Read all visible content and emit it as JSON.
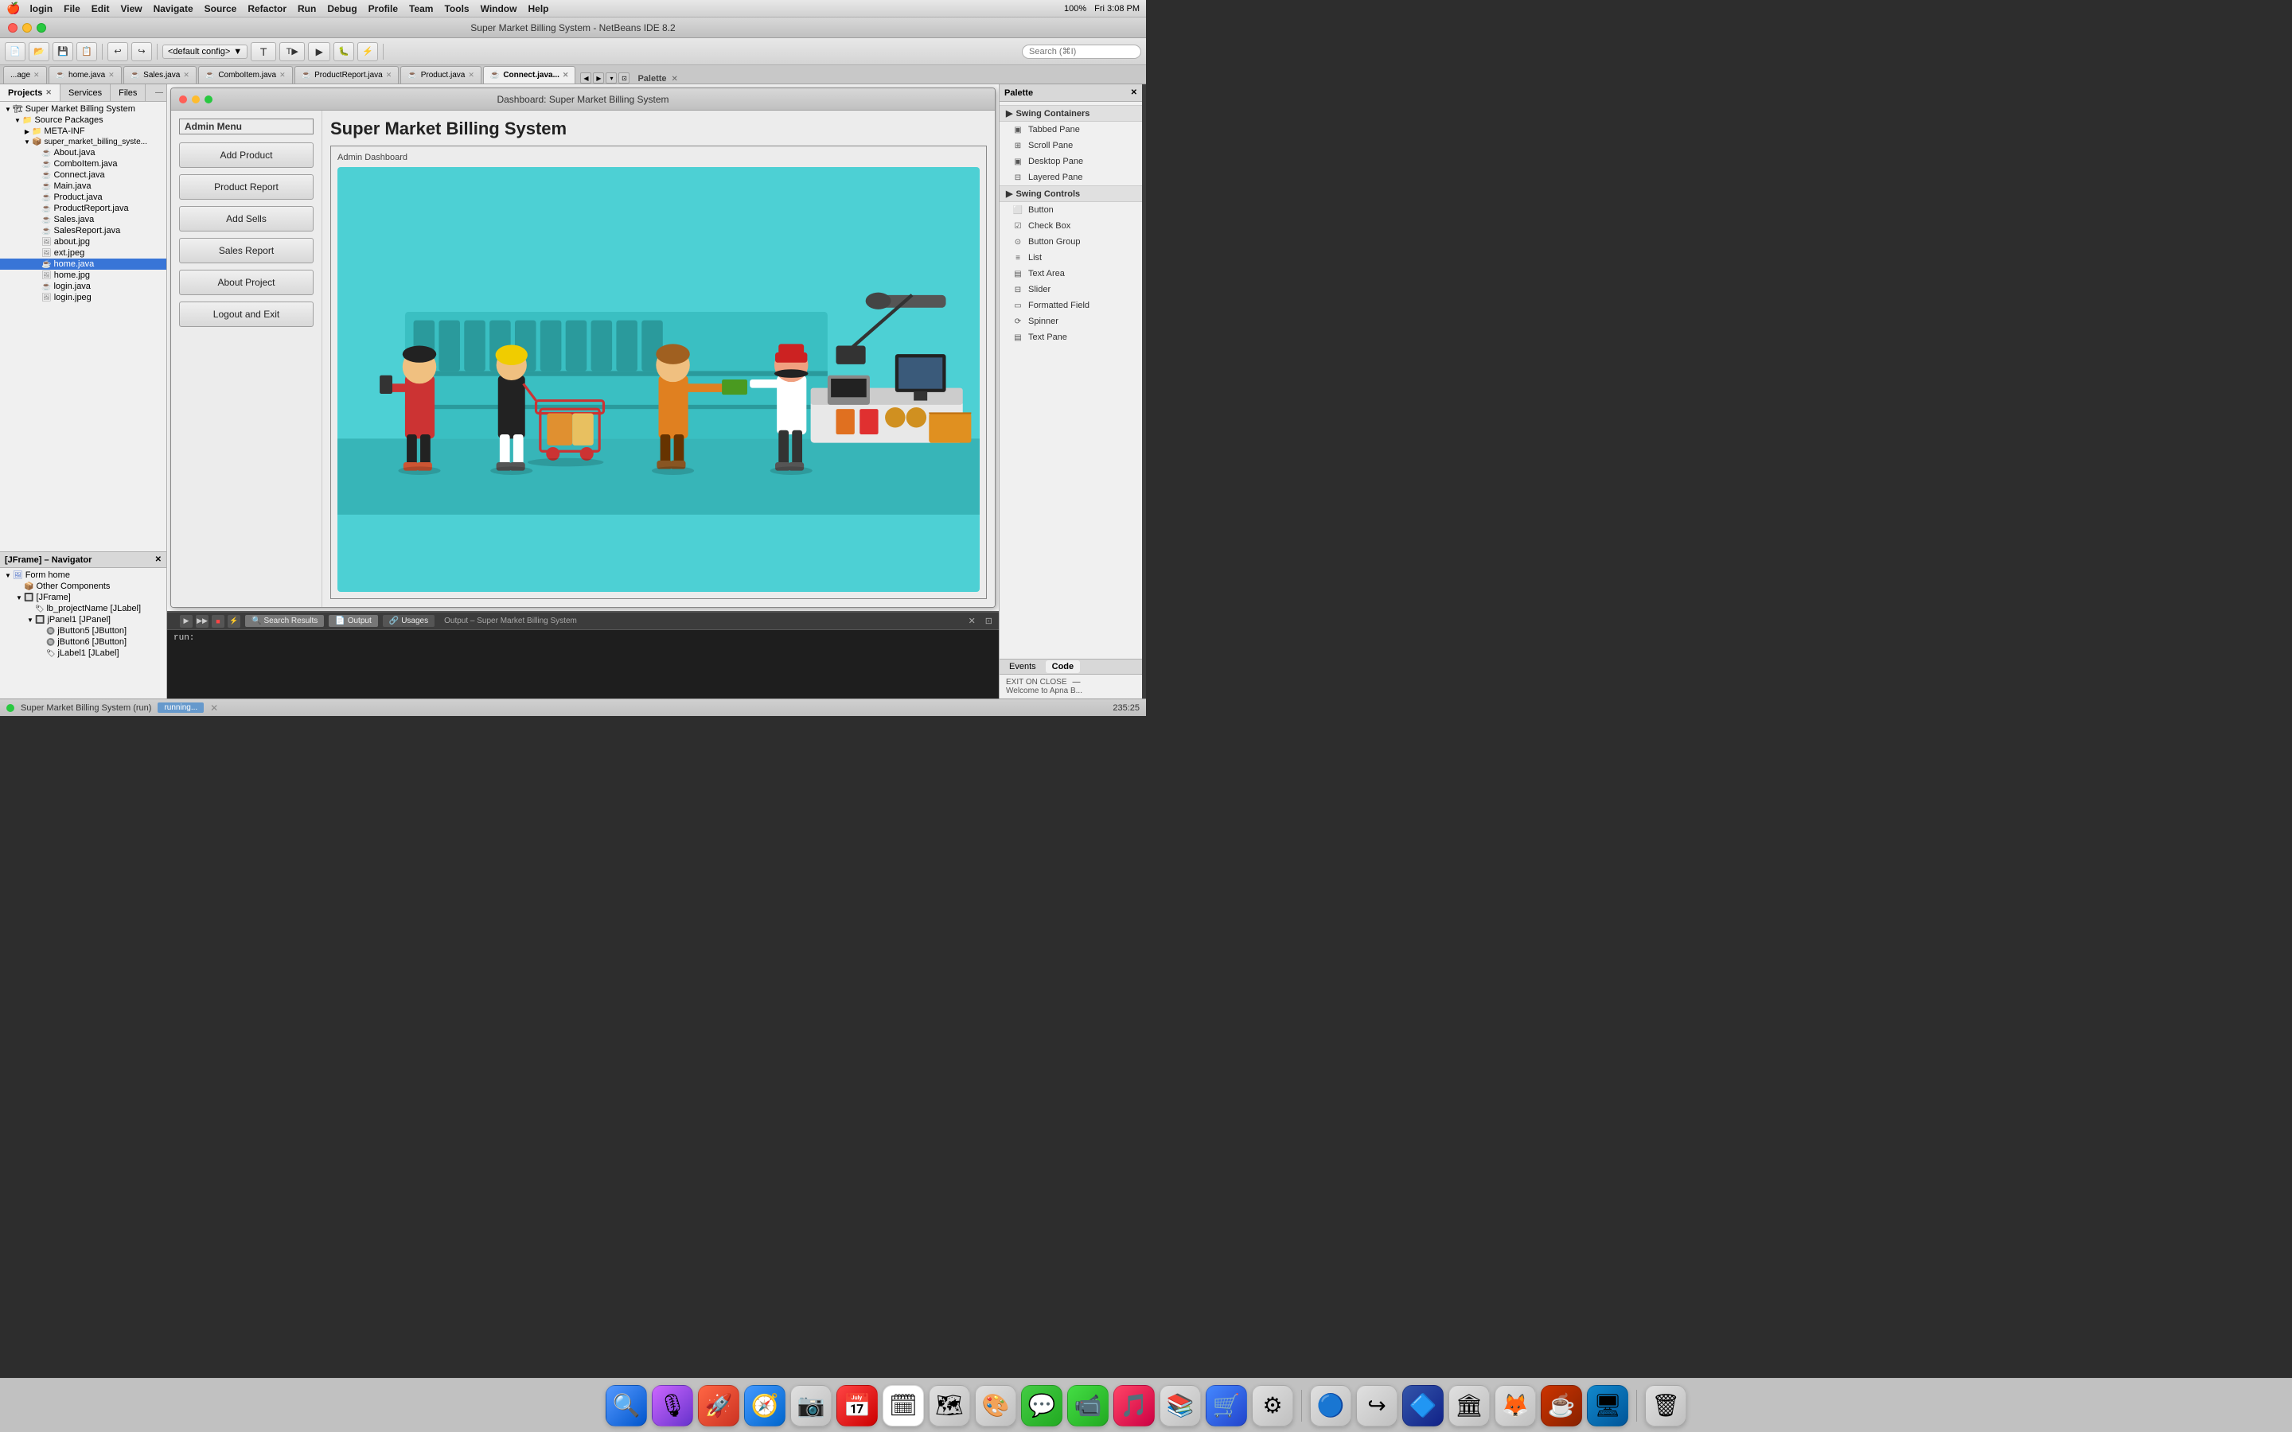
{
  "menubar": {
    "apple": "🍎",
    "app_name": "login",
    "items": [
      "login",
      "File",
      "Edit",
      "View",
      "Navigate",
      "Source",
      "Refactor",
      "Run",
      "Debug",
      "Profile",
      "Team",
      "Tools",
      "Window",
      "Help"
    ],
    "right": {
      "time": "Fri 3:08 PM",
      "battery": "100%"
    }
  },
  "title_bar": {
    "title": "Super Market Billing System - NetBeans IDE 8.2"
  },
  "toolbar": {
    "config_label": "<default config>",
    "search_placeholder": "Search (⌘I)"
  },
  "tabs": [
    {
      "label": "...age",
      "active": false
    },
    {
      "label": "home.java",
      "active": false
    },
    {
      "label": "Sales.java",
      "active": false
    },
    {
      "label": "ComboItem.java",
      "active": false
    },
    {
      "label": "ProductReport.java",
      "active": false
    },
    {
      "label": "Product.java",
      "active": false
    },
    {
      "label": "Connect.java...",
      "active": true
    }
  ],
  "panel_tabs": [
    {
      "label": "Projects",
      "active": true
    },
    {
      "label": "Services",
      "active": false
    },
    {
      "label": "Files",
      "active": false
    }
  ],
  "project_tree": {
    "root": "Super Market Billing System",
    "items": [
      {
        "label": "Source Packages",
        "indent": 1,
        "expanded": true,
        "icon": "📁"
      },
      {
        "label": "META-INF",
        "indent": 2,
        "expanded": false,
        "icon": "📁"
      },
      {
        "label": "super_market_billing_syste...",
        "indent": 2,
        "expanded": true,
        "icon": "📁"
      },
      {
        "label": "About.java",
        "indent": 3,
        "expanded": false,
        "icon": "☕"
      },
      {
        "label": "ComboItem.java",
        "indent": 3,
        "expanded": false,
        "icon": "☕"
      },
      {
        "label": "Connect.java",
        "indent": 3,
        "expanded": false,
        "icon": "☕"
      },
      {
        "label": "Main.java",
        "indent": 3,
        "expanded": false,
        "icon": "☕"
      },
      {
        "label": "Product.java",
        "indent": 3,
        "expanded": false,
        "icon": "☕"
      },
      {
        "label": "ProductReport.java",
        "indent": 3,
        "expanded": false,
        "icon": "☕"
      },
      {
        "label": "Sales.java",
        "indent": 3,
        "expanded": false,
        "icon": "☕"
      },
      {
        "label": "SalesReport.java",
        "indent": 3,
        "expanded": false,
        "icon": "☕"
      },
      {
        "label": "about.jpg",
        "indent": 3,
        "expanded": false,
        "icon": "🖼"
      },
      {
        "label": "ext.jpeg",
        "indent": 3,
        "expanded": false,
        "icon": "🖼"
      },
      {
        "label": "home.java",
        "indent": 3,
        "expanded": false,
        "icon": "☕",
        "selected": true
      },
      {
        "label": "home.jpg",
        "indent": 3,
        "expanded": false,
        "icon": "🖼"
      },
      {
        "label": "login.java",
        "indent": 3,
        "expanded": false,
        "icon": "☕"
      },
      {
        "label": "login.jpeg",
        "indent": 3,
        "expanded": false,
        "icon": "🖼"
      }
    ]
  },
  "navigator": {
    "title": "[JFrame] – Navigator",
    "items": [
      {
        "label": "Form home",
        "indent": 0,
        "icon": "🖼",
        "expanded": true
      },
      {
        "label": "Other Components",
        "indent": 1,
        "icon": "📦"
      },
      {
        "label": "[JFrame]",
        "indent": 1,
        "icon": "🔲",
        "expanded": true
      },
      {
        "label": "lb_projectName [JLabel]",
        "indent": 2,
        "icon": "🏷"
      },
      {
        "label": "jPanel1 [JPanel]",
        "indent": 2,
        "icon": "🔲",
        "expanded": true
      },
      {
        "label": "jButton5 [JButton]",
        "indent": 3,
        "icon": "🔘"
      },
      {
        "label": "jButton6 [JButton]",
        "indent": 3,
        "icon": "🔘"
      },
      {
        "label": "jLabel1 [JLabel]",
        "indent": 3,
        "icon": "🏷"
      }
    ]
  },
  "app_preview": {
    "title": "Dashboard: Super Market Billing System",
    "main_title": "Super Market Billing System",
    "section_title": "Admin Dashboard",
    "admin_menu": {
      "title": "Admin Menu",
      "buttons": [
        "Add Product",
        "Product Report",
        "Add Sells",
        "Sales Report",
        "About Project",
        "Logout and Exit"
      ]
    }
  },
  "output_panel": {
    "title": "Output – Super Market Billing System",
    "tabs": [
      "Search Results",
      "Output",
      "Usages"
    ],
    "active_tab": "Output",
    "content": "run:"
  },
  "status_bar": {
    "project": "Super Market Billing System (run)",
    "run_status": "running...",
    "position": "235:25"
  },
  "palette": {
    "title": "Palette",
    "sections": [
      {
        "title": "Swing Containers",
        "items": [
          {
            "label": "Tabbed Pane",
            "icon": "▣"
          },
          {
            "label": "Scroll Pane",
            "icon": "▣"
          },
          {
            "label": "Desktop Pane",
            "icon": "▣"
          },
          {
            "label": "Layered Pane",
            "icon": "▣"
          }
        ]
      },
      {
        "title": "Swing Controls",
        "items": [
          {
            "label": "Button",
            "icon": "⬜"
          },
          {
            "label": "Check Box",
            "icon": "☑"
          },
          {
            "label": "Button Group",
            "icon": "⊙"
          },
          {
            "label": "List",
            "icon": "≡"
          },
          {
            "label": "Text Area",
            "icon": "▤"
          },
          {
            "label": "Slider",
            "icon": "⊟"
          },
          {
            "label": "Formatted Field",
            "icon": "▭"
          },
          {
            "label": "Spinner",
            "icon": "⟳"
          },
          {
            "label": "Text Pane",
            "icon": "▤"
          }
        ]
      }
    ]
  },
  "events": {
    "tabs": [
      "Events",
      "Code"
    ],
    "active_tab": "Code",
    "property_label": "EXIT ON CLOSE",
    "property_value": "—",
    "watermark": "Welcome to Apna B..."
  },
  "dock_items": [
    {
      "icon": "🔍",
      "label": "Finder"
    },
    {
      "icon": "🎙",
      "label": "Siri"
    },
    {
      "icon": "🚀",
      "label": "Launchpad"
    },
    {
      "icon": "🧭",
      "label": "Safari"
    },
    {
      "icon": "🗂",
      "label": "Screenshot"
    },
    {
      "icon": "📅",
      "label": "Calendar"
    },
    {
      "icon": "🗓",
      "label": "Reminders"
    },
    {
      "icon": "📍",
      "label": "Maps"
    },
    {
      "icon": "🎨",
      "label": "Photos"
    },
    {
      "icon": "💬",
      "label": "Messages"
    },
    {
      "icon": "🟢",
      "label": "FaceTime"
    },
    {
      "icon": "🎵",
      "label": "Music"
    },
    {
      "icon": "📚",
      "label": "Books"
    },
    {
      "icon": "🛒",
      "label": "App Store"
    },
    {
      "icon": "⚙",
      "label": "System Prefs"
    },
    {
      "icon": "🔵",
      "label": "Chrome"
    },
    {
      "icon": "↪",
      "label": "Arrow"
    },
    {
      "icon": "🔷",
      "label": "Blue App"
    },
    {
      "icon": "🏛",
      "label": "Library"
    },
    {
      "icon": "🦊",
      "label": "Firefox"
    },
    {
      "icon": "☕",
      "label": "Java"
    },
    {
      "icon": "🖥",
      "label": "NetBeans"
    },
    {
      "icon": "🗑",
      "label": "Trash"
    }
  ]
}
